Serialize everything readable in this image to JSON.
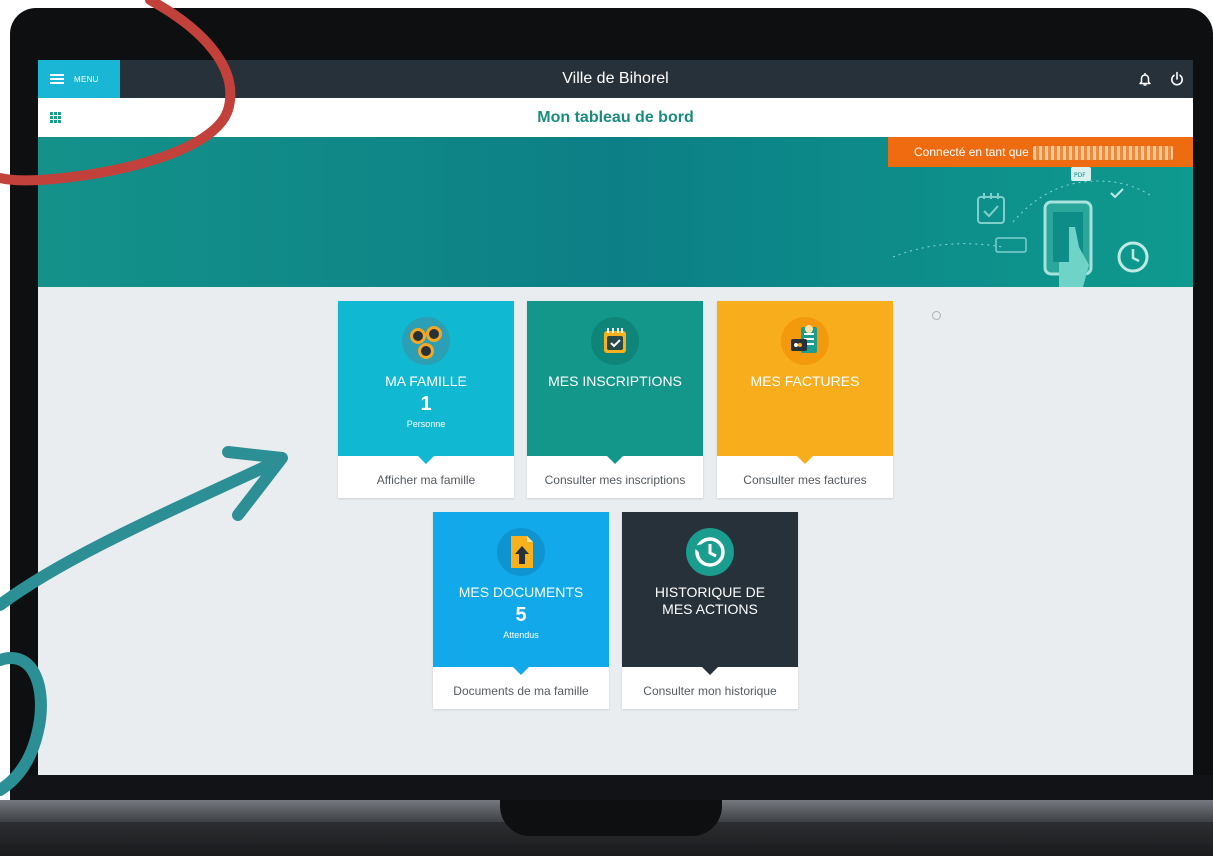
{
  "topbar": {
    "menu_label": "MENU",
    "app_title": "Ville de Bihorel",
    "bell_icon": "bell-icon",
    "power_icon": "power-icon"
  },
  "subbar": {
    "grid_icon": "apps-grid-icon",
    "page_title": "Mon tableau de bord"
  },
  "banner": {
    "connected_label": "Connecté en tant que",
    "art_badge": "PDF"
  },
  "tiles": [
    {
      "title": "MA FAMILLE",
      "count": "1",
      "sub": "Personne",
      "footer": "Afficher ma famille",
      "color": "#10b8d2",
      "icon": "family-icon"
    },
    {
      "title": "MES INSCRIPTIONS",
      "count": "",
      "sub": "",
      "footer": "Consulter mes inscriptions",
      "color": "#13978a",
      "icon": "calendar-check-icon"
    },
    {
      "title": "MES FACTURES",
      "count": "",
      "sub": "",
      "footer": "Consulter mes factures",
      "color": "#f8ad1d",
      "icon": "invoice-card-icon"
    },
    {
      "title": "MES DOCUMENTS",
      "count": "5",
      "sub": "Attendus",
      "footer": "Documents de ma famille",
      "color": "#11a9ea",
      "icon": "document-upload-icon"
    },
    {
      "title_line1": "HISTORIQUE DE",
      "title_line2": "MES ACTIONS",
      "count": "",
      "sub": "",
      "footer": "Consulter mon historique",
      "color": "#27313a",
      "icon": "history-icon"
    }
  ],
  "colors": {
    "topbar": "#27313a",
    "menu": "#1ab6d6",
    "title_green": "#1a8c7e",
    "banner": "#0e8c88",
    "connected": "#ef6b10",
    "annotation_red": "#c2413a",
    "annotation_teal": "#2b8f95"
  }
}
